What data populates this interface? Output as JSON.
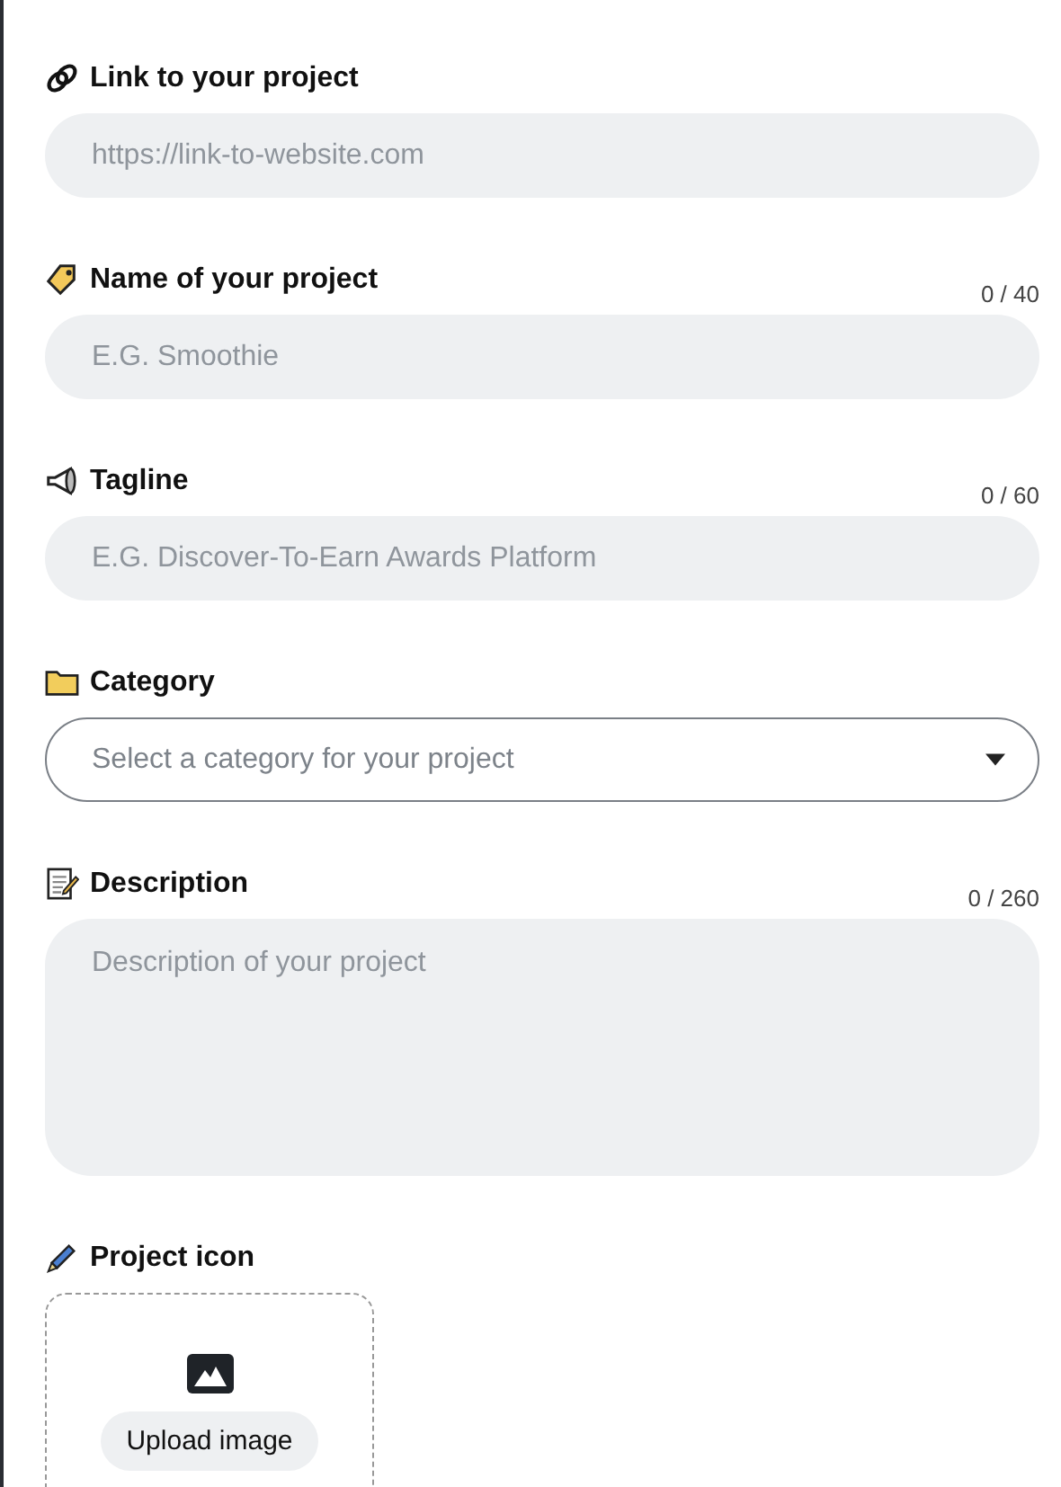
{
  "fields": [
    {
      "kind": "text",
      "label": "Link to your project",
      "placeholder": "https://link-to-website.com"
    },
    {
      "kind": "text",
      "label": "Name of your project",
      "counter": "0 / 40",
      "placeholder": "E.G. Smoothie"
    },
    {
      "kind": "text",
      "label": "Tagline",
      "counter": "0 / 60",
      "placeholder": "E.G. Discover-To-Earn Awards Platform"
    },
    {
      "kind": "select",
      "label": "Category",
      "placeholder": "Select a category for your project"
    },
    {
      "kind": "textarea",
      "label": "Description",
      "counter": "0 / 260",
      "placeholder": "Description of your project"
    }
  ],
  "project_icon": {
    "label": "Project icon",
    "button": "Upload image"
  }
}
